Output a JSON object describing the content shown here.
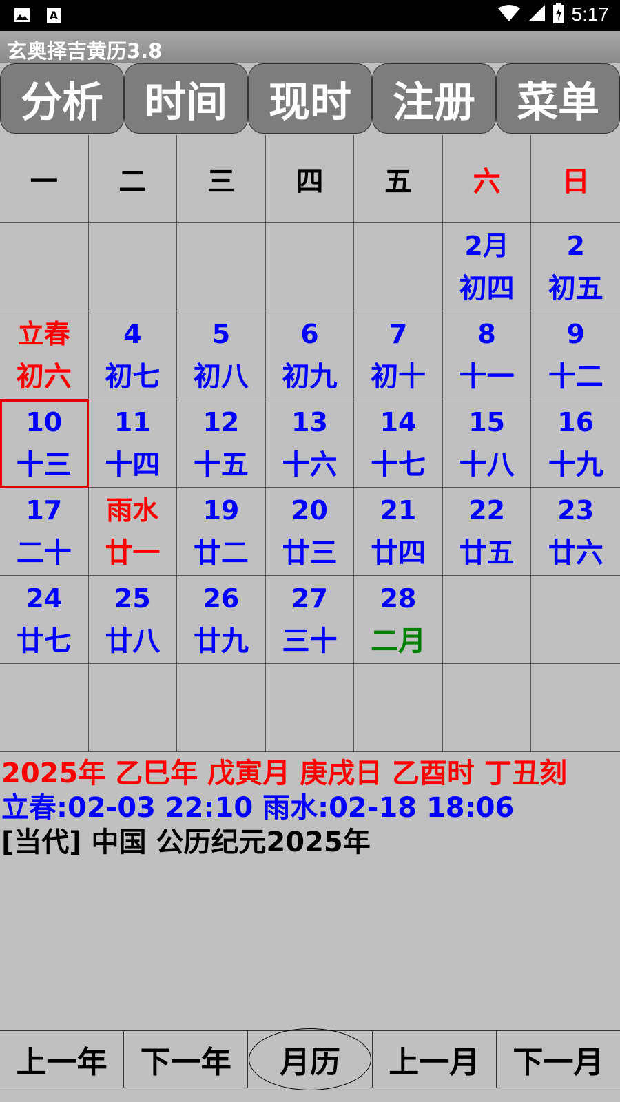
{
  "status": {
    "time": "5:17"
  },
  "app": {
    "title": "玄奥择吉黄历3.8"
  },
  "top_buttons": [
    "分析",
    "时间",
    "现时",
    "注册",
    "菜单"
  ],
  "weekdays": [
    "一",
    "二",
    "三",
    "四",
    "五",
    "六",
    "日"
  ],
  "calendar": [
    [
      {
        "d": "",
        "l": ""
      },
      {
        "d": "",
        "l": ""
      },
      {
        "d": "",
        "l": ""
      },
      {
        "d": "",
        "l": ""
      },
      {
        "d": "",
        "l": ""
      },
      {
        "d": "2月",
        "l": "初四"
      },
      {
        "d": "2",
        "l": "初五"
      }
    ],
    [
      {
        "d": "立春",
        "l": "初六"
      },
      {
        "d": "4",
        "l": "初七"
      },
      {
        "d": "5",
        "l": "初八"
      },
      {
        "d": "6",
        "l": "初九"
      },
      {
        "d": "7",
        "l": "初十"
      },
      {
        "d": "8",
        "l": "十一"
      },
      {
        "d": "9",
        "l": "十二"
      }
    ],
    [
      {
        "d": "10",
        "l": "十三"
      },
      {
        "d": "11",
        "l": "十四"
      },
      {
        "d": "12",
        "l": "十五"
      },
      {
        "d": "13",
        "l": "十六"
      },
      {
        "d": "14",
        "l": "十七"
      },
      {
        "d": "15",
        "l": "十八"
      },
      {
        "d": "16",
        "l": "十九"
      }
    ],
    [
      {
        "d": "17",
        "l": "二十"
      },
      {
        "d": "雨水",
        "l": "廿一"
      },
      {
        "d": "19",
        "l": "廿二"
      },
      {
        "d": "20",
        "l": "廿三"
      },
      {
        "d": "21",
        "l": "廿四"
      },
      {
        "d": "22",
        "l": "廿五"
      },
      {
        "d": "23",
        "l": "廿六"
      }
    ],
    [
      {
        "d": "24",
        "l": "廿七"
      },
      {
        "d": "25",
        "l": "廿八"
      },
      {
        "d": "26",
        "l": "廿九"
      },
      {
        "d": "27",
        "l": "三十"
      },
      {
        "d": "28",
        "l": "二月"
      },
      {
        "d": "",
        "l": ""
      },
      {
        "d": "",
        "l": ""
      }
    ],
    [
      {
        "d": "",
        "l": ""
      },
      {
        "d": "",
        "l": ""
      },
      {
        "d": "",
        "l": ""
      },
      {
        "d": "",
        "l": ""
      },
      {
        "d": "",
        "l": ""
      },
      {
        "d": "",
        "l": ""
      },
      {
        "d": "",
        "l": ""
      }
    ]
  ],
  "info": {
    "line1": "2025年 乙巳年 戊寅月 庚戌日 乙酉时 丁丑刻",
    "line2": "立春:02-03 22:10  雨水:02-18 18:06",
    "line3": "[当代] 中国  公历纪元2025年"
  },
  "bottom_buttons": [
    "上一年",
    "下一年",
    "月历",
    "上一月",
    "下一月"
  ],
  "colors": {
    "term": "#ff0000",
    "date": "#0000ff",
    "month_start": "#008000",
    "selected_border": "#e00000"
  }
}
